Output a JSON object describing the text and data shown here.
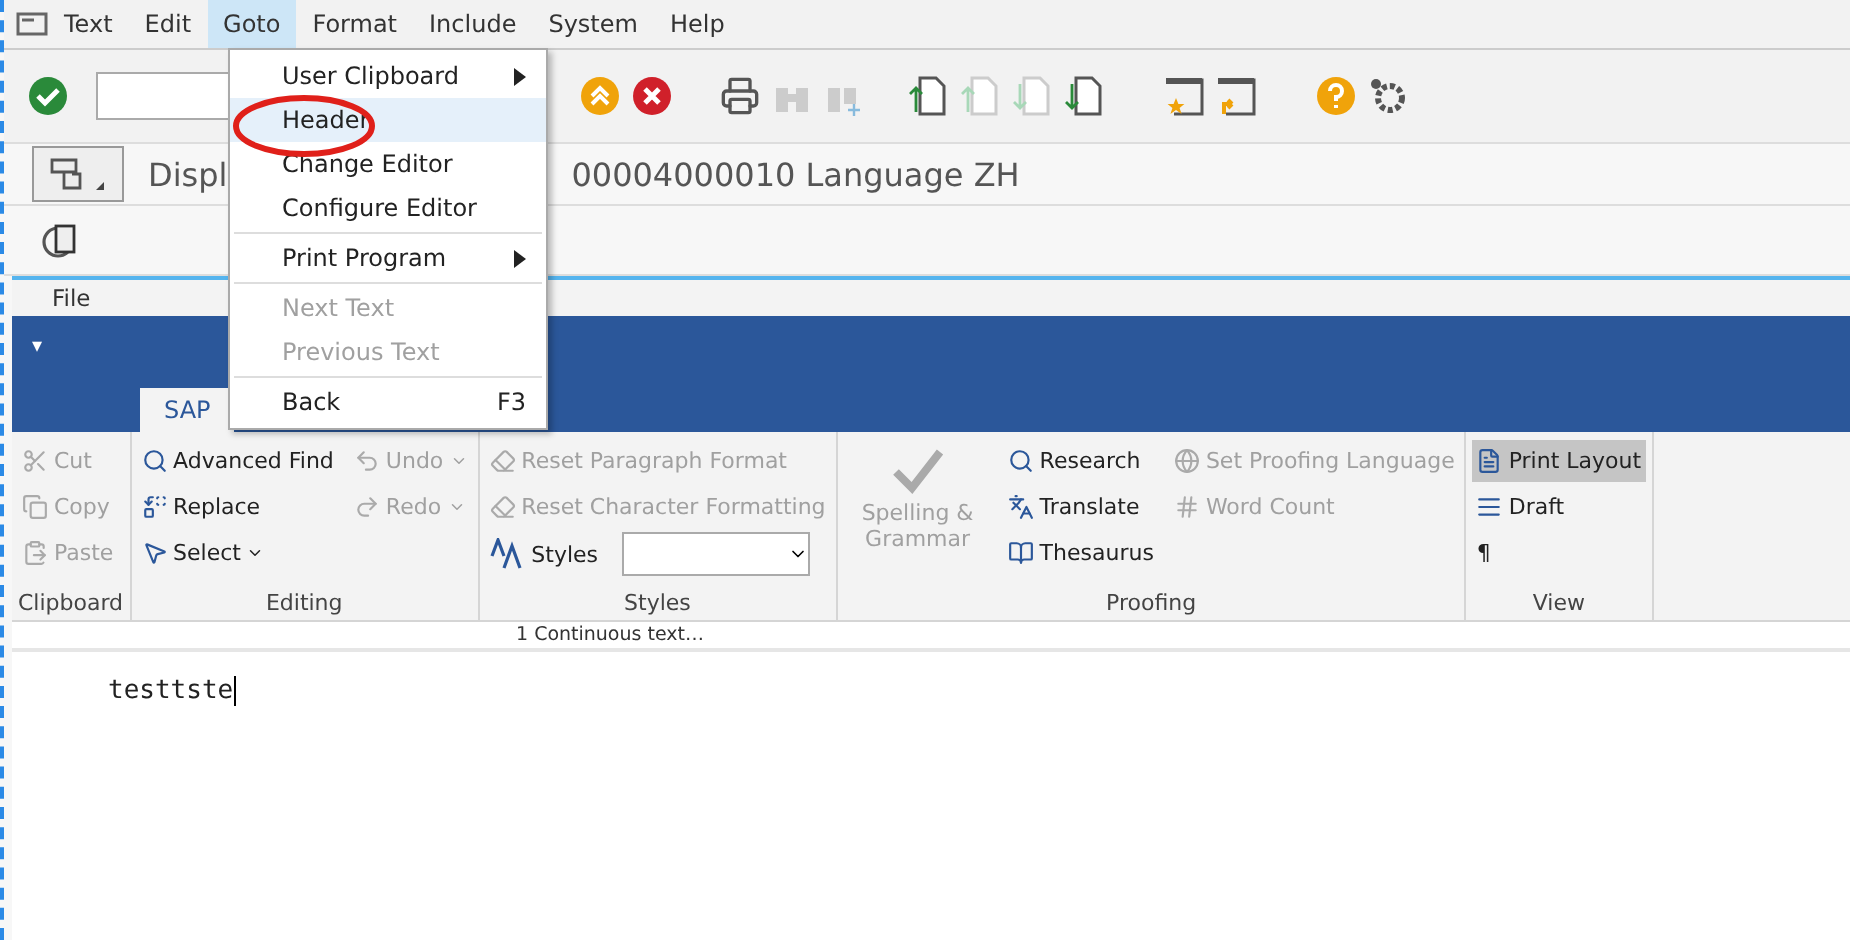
{
  "menu_bar": {
    "items": [
      {
        "label": "Text",
        "selected": false
      },
      {
        "label": "Edit",
        "selected": false
      },
      {
        "label": "Goto",
        "selected": true
      },
      {
        "label": "Format",
        "selected": false
      },
      {
        "label": "Include",
        "selected": false
      },
      {
        "label": "System",
        "selected": false
      },
      {
        "label": "Help",
        "selected": false
      }
    ]
  },
  "title": {
    "visible_start": "Displ",
    "visible_end": "00004000010 Language ZH"
  },
  "goto_menu": {
    "items": [
      {
        "kind": "item",
        "label": "User Clipboard",
        "submenu": true,
        "disabled": false,
        "highlighted": false
      },
      {
        "kind": "item",
        "label": "Header",
        "submenu": false,
        "disabled": false,
        "highlighted": true
      },
      {
        "kind": "item",
        "label": "Change Editor",
        "submenu": false,
        "disabled": false,
        "highlighted": false
      },
      {
        "kind": "item",
        "label": "Configure Editor",
        "submenu": false,
        "disabled": false,
        "highlighted": false
      },
      {
        "kind": "separator"
      },
      {
        "kind": "item",
        "label": "Print Program",
        "submenu": true,
        "disabled": false,
        "highlighted": false
      },
      {
        "kind": "separator"
      },
      {
        "kind": "item",
        "label": "Next Text",
        "submenu": false,
        "disabled": true,
        "highlighted": false
      },
      {
        "kind": "item",
        "label": "Previous Text",
        "submenu": false,
        "disabled": true,
        "highlighted": false
      },
      {
        "kind": "separator"
      },
      {
        "kind": "item",
        "label": "Back",
        "shortcut": "F3",
        "submenu": false,
        "disabled": false,
        "highlighted": false
      }
    ]
  },
  "editor": {
    "file_tab": "File",
    "quick_access": "▾",
    "ribbon_tabs": [
      {
        "label": "SAP",
        "selected": true
      }
    ],
    "groups": [
      {
        "label": "Clipboard",
        "columns": [
          [
            {
              "kind": "small",
              "label": "Cut",
              "disabled": true
            },
            {
              "kind": "small",
              "label": "Copy",
              "disabled": true
            },
            {
              "kind": "small",
              "label": "Paste",
              "disabled": true
            }
          ]
        ]
      },
      {
        "label": "Editing",
        "columns": [
          [
            {
              "kind": "small",
              "label": "Advanced Find",
              "disabled": false
            },
            {
              "kind": "small",
              "label": "Replace",
              "disabled": false
            },
            {
              "kind": "small",
              "label": "Select",
              "disabled": false,
              "dropdown": true
            }
          ],
          [
            {
              "kind": "small",
              "label": "Undo",
              "disabled": true,
              "dropdown": true
            },
            {
              "kind": "small",
              "label": "Redo",
              "disabled": true,
              "dropdown": true
            }
          ]
        ]
      },
      {
        "label": "Styles",
        "columns": [
          [
            {
              "kind": "small",
              "label": "Reset Paragraph Format",
              "disabled": true
            },
            {
              "kind": "small",
              "label": "Reset Character Formatting",
              "disabled": true
            },
            {
              "kind": "combo",
              "label": "Styles",
              "disabled": false
            }
          ]
        ]
      },
      {
        "label": "Proofing",
        "columns": [
          [
            {
              "kind": "large",
              "label": "Spelling & Grammar",
              "disabled": true
            }
          ],
          [
            {
              "kind": "small",
              "label": "Research",
              "disabled": false
            },
            {
              "kind": "small",
              "label": "Translate",
              "disabled": false
            },
            {
              "kind": "small",
              "label": "Thesaurus",
              "disabled": false
            }
          ],
          [
            {
              "kind": "small",
              "label": "Set Proofing Language",
              "disabled": true
            },
            {
              "kind": "small",
              "label": "Word Count",
              "disabled": true
            }
          ]
        ]
      },
      {
        "label": "View",
        "columns": [
          [
            {
              "kind": "small",
              "label": "Print Layout",
              "disabled": false,
              "selected": true
            },
            {
              "kind": "small",
              "label": "Draft",
              "disabled": false,
              "selected": false
            },
            {
              "kind": "small",
              "label": "¶",
              "disabled": false,
              "selected": false
            }
          ]
        ]
      }
    ],
    "status_field": "1 Continuous text…",
    "document_text": "testtste"
  }
}
